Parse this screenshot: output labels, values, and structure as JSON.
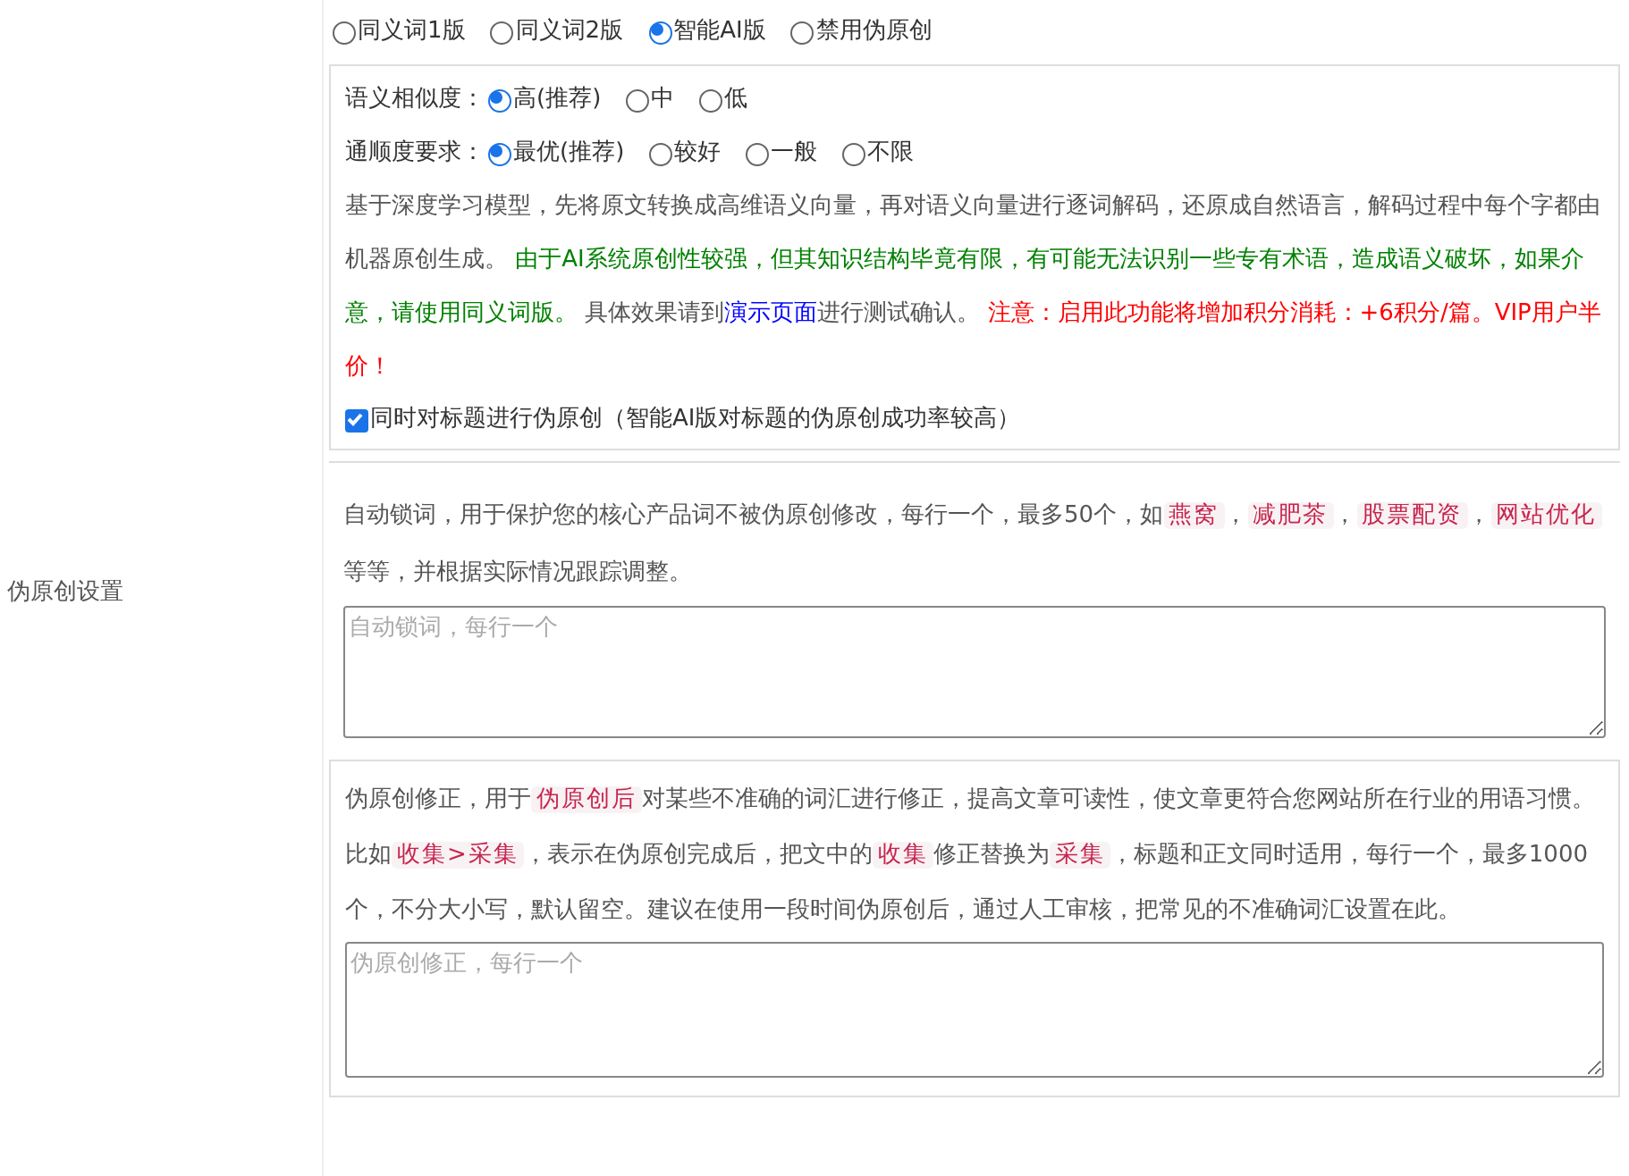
{
  "section_label": "伪原创设置",
  "versions": [
    {
      "label": "同义词1版",
      "selected": false
    },
    {
      "label": "同义词2版",
      "selected": false
    },
    {
      "label": "智能AI版",
      "selected": true
    },
    {
      "label": "禁用伪原创",
      "selected": false
    }
  ],
  "similarity": {
    "label": "语义相似度：",
    "options": [
      {
        "label": "高(推荐)",
        "selected": true
      },
      {
        "label": "中",
        "selected": false
      },
      {
        "label": "低",
        "selected": false
      }
    ]
  },
  "fluency": {
    "label": "通顺度要求：",
    "options": [
      {
        "label": "最优(推荐)",
        "selected": true
      },
      {
        "label": "较好",
        "selected": false
      },
      {
        "label": "一般",
        "selected": false
      },
      {
        "label": "不限",
        "selected": false
      }
    ]
  },
  "description": [
    {
      "kind": "plain",
      "text": "基于深度学习模型，先将原文转换成高维语义向量，再对语义向量进行逐词解码，还原成自然语言，解码过程中每个字都由机器原创生成。 "
    },
    {
      "kind": "green",
      "text": "由于AI系统原创性较强，但其知识结构毕竟有限，有可能无法识别一些专有术语，造成语义破坏，如果介意，请使用同义词版。"
    },
    {
      "kind": "plain",
      "text": " 具体效果请到"
    },
    {
      "kind": "link",
      "text": "演示页面"
    },
    {
      "kind": "plain",
      "text": "进行测试确认。 "
    },
    {
      "kind": "red",
      "text": "注意：启用此功能将增加积分消耗：+6积分/篇。VIP用户半价！"
    }
  ],
  "title_checkbox": {
    "label": "同时对标题进行伪原创（智能AI版对标题的伪原创成功率较高）",
    "checked": true
  },
  "lock_words": {
    "description": [
      {
        "kind": "plain",
        "text": "自动锁词，用于保护您的核心产品词不被伪原创修改，每行一个，最多50个，如"
      },
      {
        "kind": "code",
        "text": "燕窝"
      },
      {
        "kind": "plain",
        "text": "，"
      },
      {
        "kind": "code",
        "text": "减肥茶"
      },
      {
        "kind": "plain",
        "text": "，"
      },
      {
        "kind": "code",
        "text": "股票配资"
      },
      {
        "kind": "plain",
        "text": "，"
      },
      {
        "kind": "code",
        "text": "网站优化"
      },
      {
        "kind": "plain",
        "text": " 等等，并根据实际情况跟踪调整。"
      }
    ],
    "placeholder": "自动锁词，每行一个"
  },
  "correction": {
    "description": [
      {
        "kind": "plain",
        "text": "伪原创修正，用于"
      },
      {
        "kind": "code",
        "text": "伪原创后"
      },
      {
        "kind": "plain",
        "text": "对某些不准确的词汇进行修正，提高文章可读性，使文章更符合您网站所在行业的用语习惯。比如"
      },
      {
        "kind": "code",
        "text": "收集>采集"
      },
      {
        "kind": "plain",
        "text": "，表示在伪原创完成后，把文中的"
      },
      {
        "kind": "code",
        "text": "收集"
      },
      {
        "kind": "plain",
        "text": "修正替换为"
      },
      {
        "kind": "code",
        "text": "采集"
      },
      {
        "kind": "plain",
        "text": "，标题和正文同时适用，每行一个，最多1000个，不分大小写，默认留空。建议在使用一段时间伪原创后，通过人工审核，把常见的不准确词汇设置在此。"
      }
    ],
    "placeholder": "伪原创修正，每行一个"
  }
}
